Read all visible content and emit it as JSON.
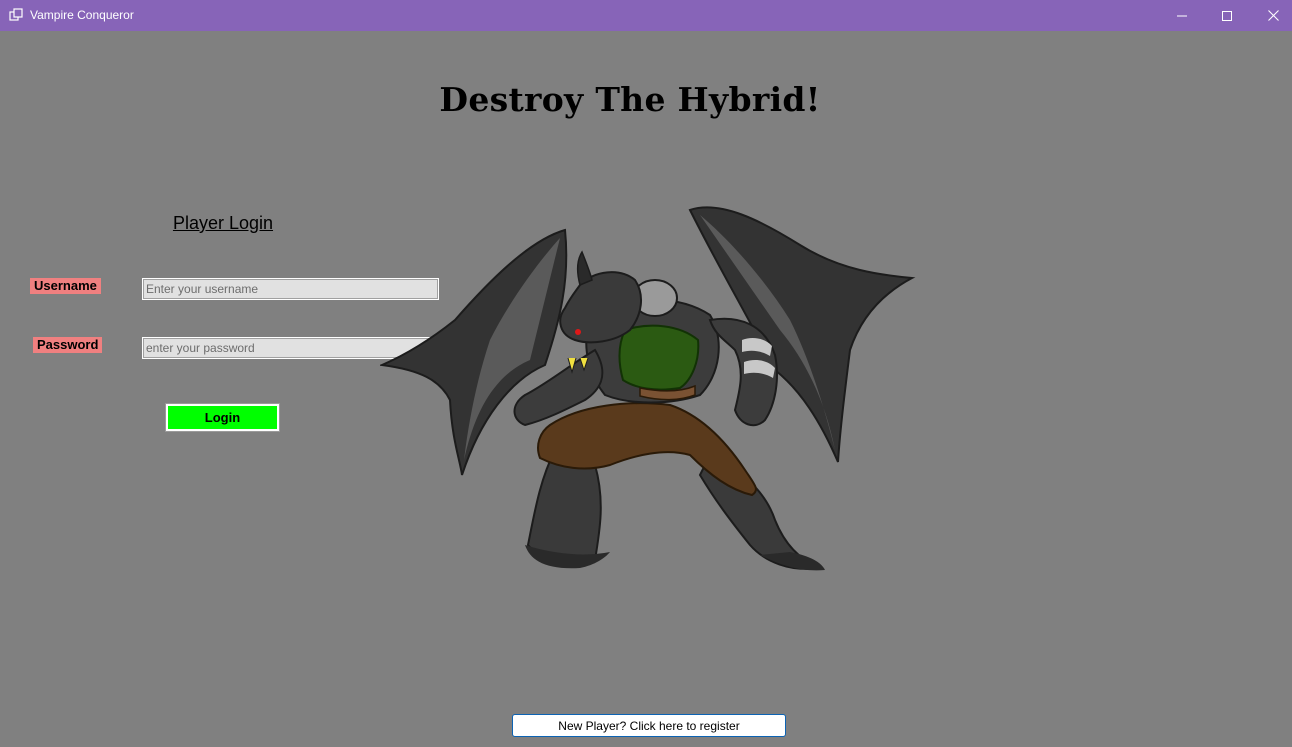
{
  "window": {
    "title": "Vampire Conqueror",
    "icon": "app-window-icon",
    "controls": [
      "minimize-icon",
      "maximize-icon",
      "close-icon"
    ]
  },
  "main": {
    "heading": "Destroy The Hybrid!"
  },
  "login": {
    "title": "Player Login",
    "username_label": "Username",
    "username_placeholder": "Enter your username",
    "username_value": "",
    "password_label": "Password",
    "password_placeholder": "enter your password",
    "password_value": "",
    "login_button": "Login"
  },
  "register": {
    "button_label": "New Player? Click here to register"
  },
  "illustration": {
    "name": "winged-werewolf-hybrid-illustration"
  },
  "colors": {
    "titlebar": "#8764b8",
    "background": "#808080",
    "label_highlight": "#f08080",
    "login_button": "#00ff00",
    "register_border": "#0c63b4"
  }
}
